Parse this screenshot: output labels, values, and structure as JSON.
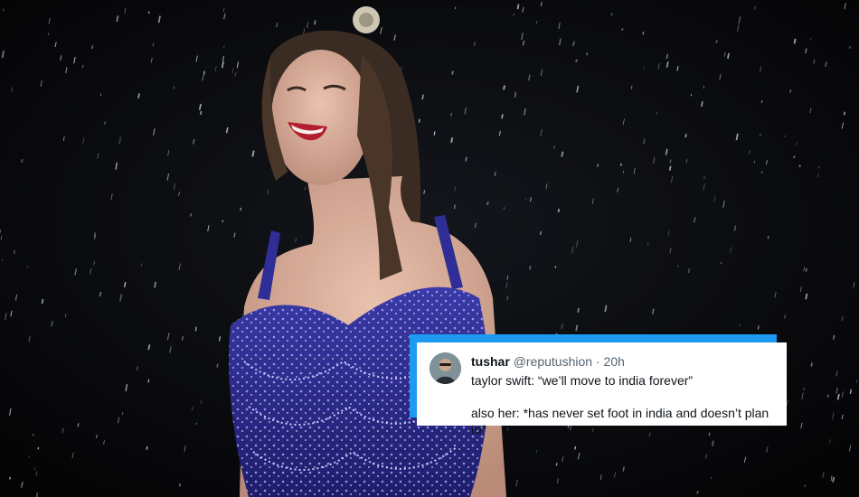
{
  "tweet": {
    "display_name": "tushar",
    "handle": "@reputushion",
    "separator": "·",
    "timestamp": "20h",
    "text_line_1": "taylor swift: “we’ll move to india forever”",
    "text_line_2": "also her: *has never set foot in india and doesn’t plan to*",
    "accent_color": "#1d9bf0"
  },
  "photo": {
    "subject": "performer-in-rain",
    "dress_color": "#2b2a8c",
    "background_color": "#050507"
  }
}
